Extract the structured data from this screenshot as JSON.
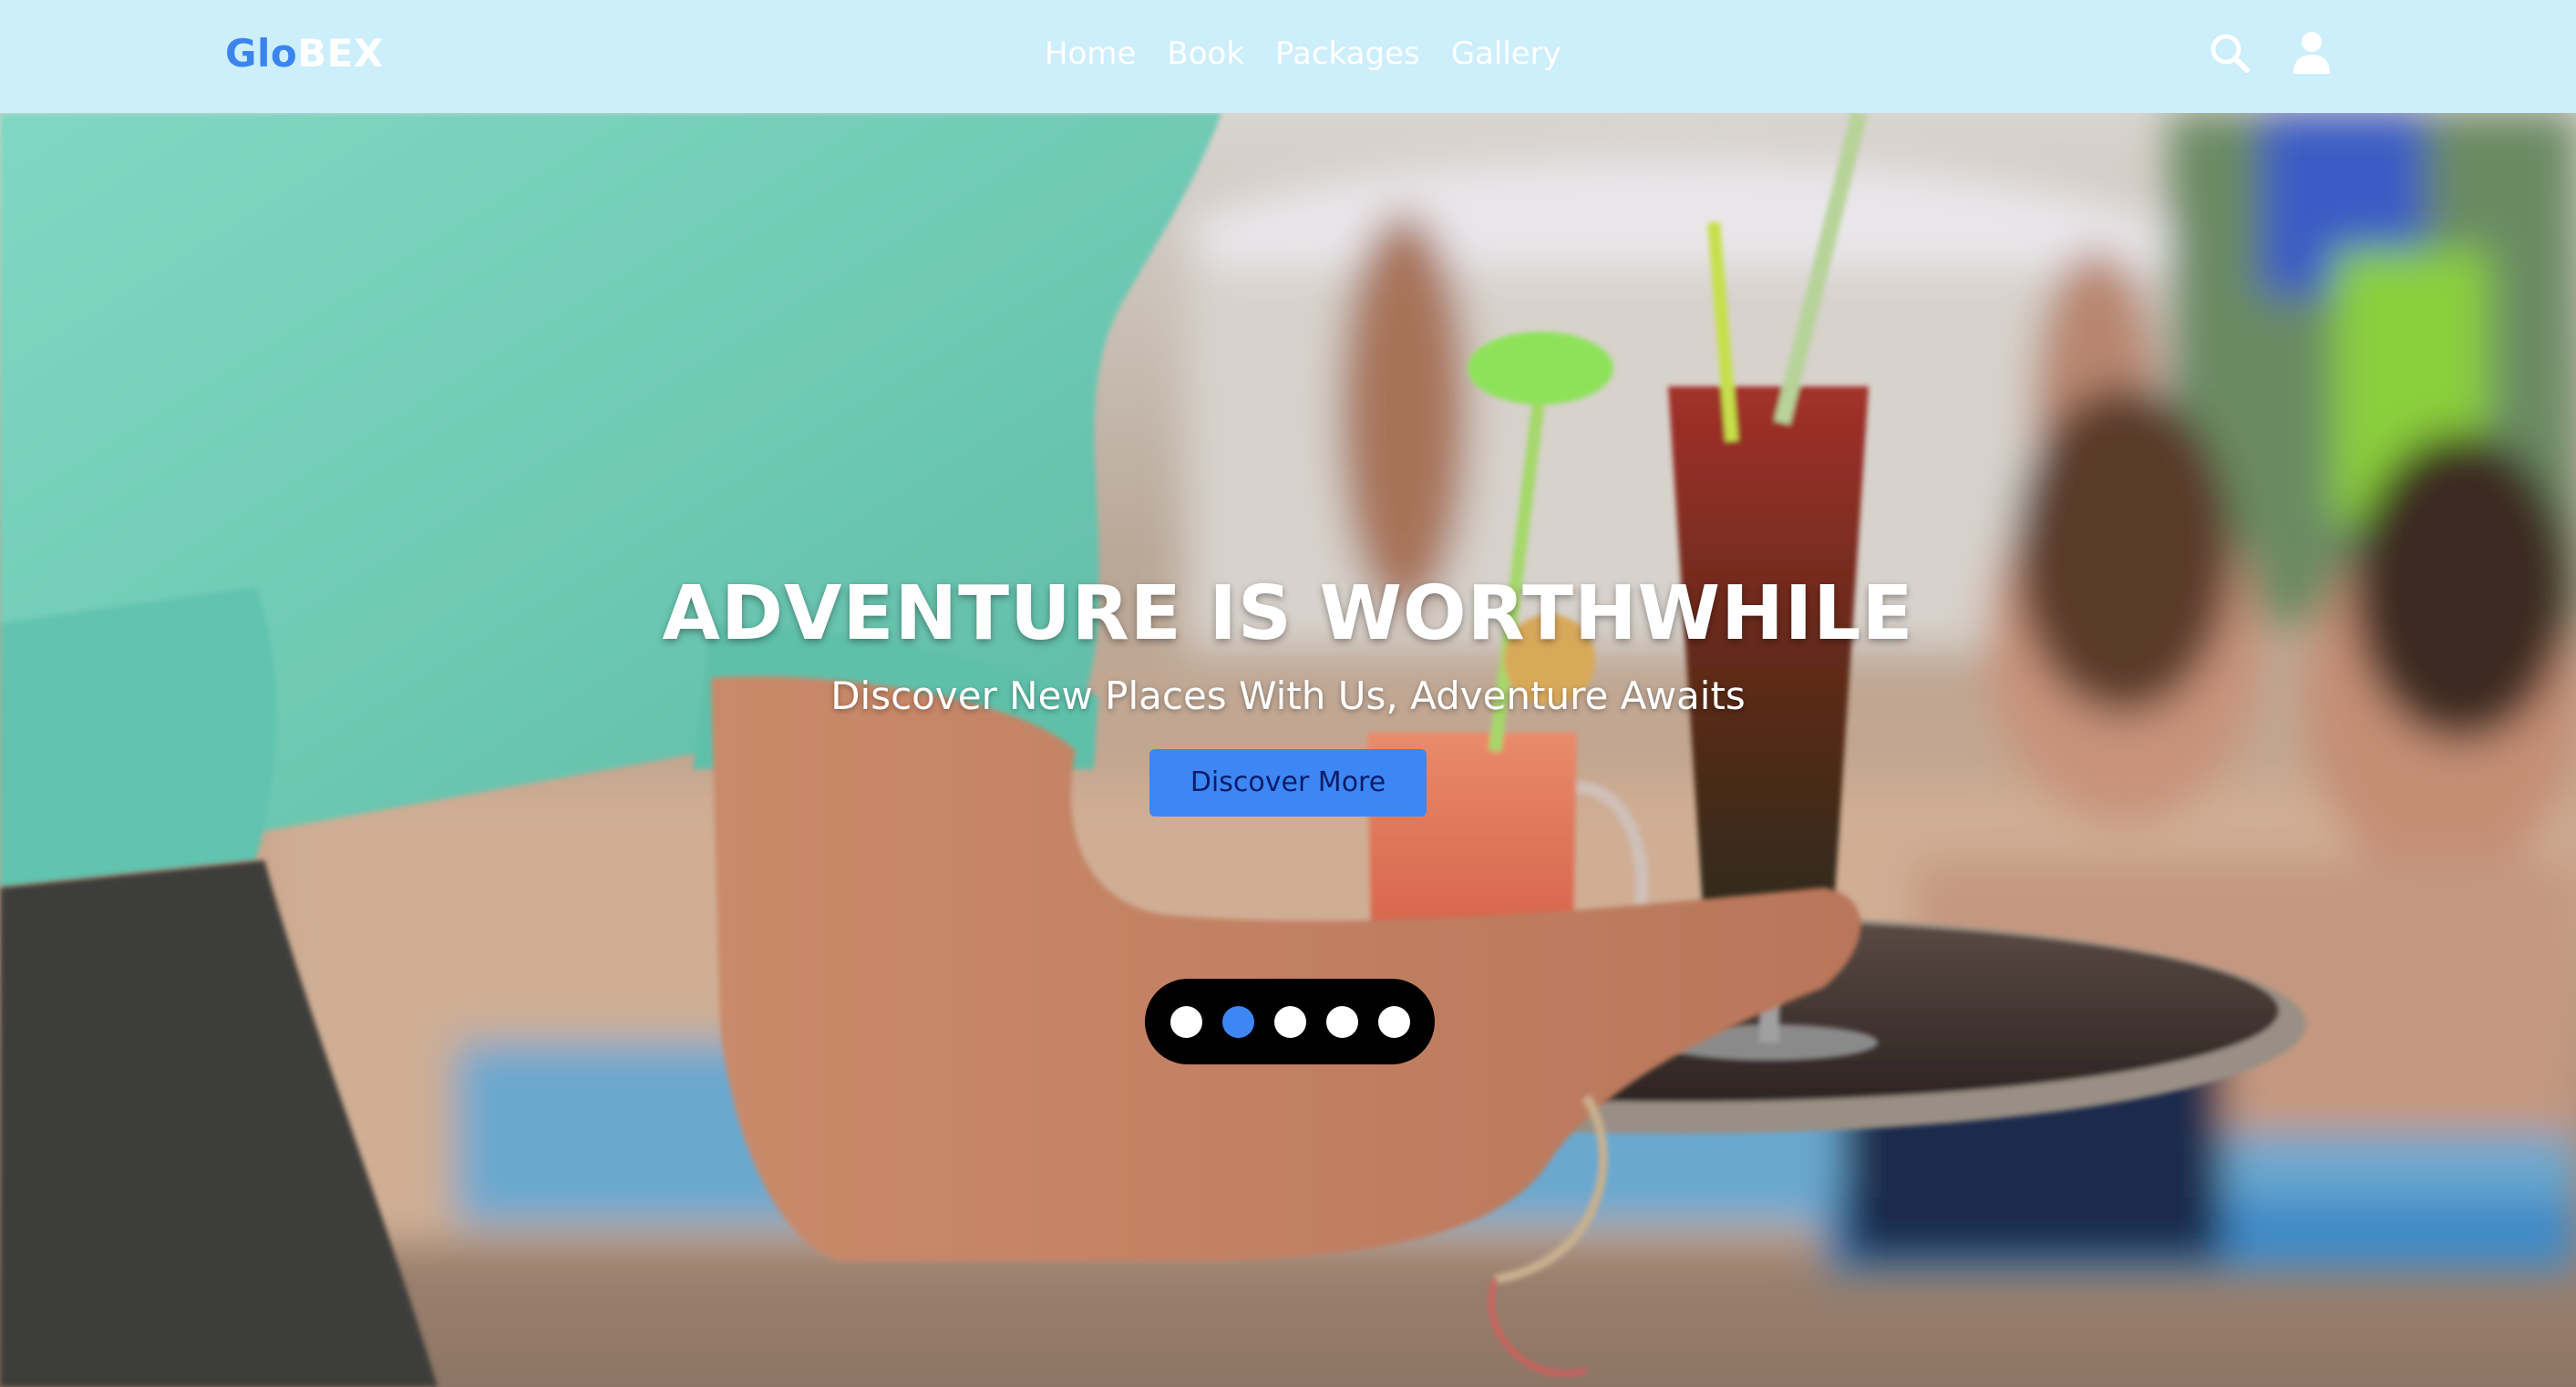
{
  "brand": {
    "logo_part1": "Glo",
    "logo_part2": "BEX",
    "accent_color": "#3b84f0",
    "header_bg": "#cdeefb"
  },
  "nav": {
    "items": [
      {
        "label": "Home"
      },
      {
        "label": "Book"
      },
      {
        "label": "Packages"
      },
      {
        "label": "Gallery"
      }
    ]
  },
  "header_icons": {
    "search": "search-icon",
    "account": "user-icon"
  },
  "hero": {
    "title": "ADVENTURE IS WORTHWHILE",
    "subtitle": "Discover New Places With Us, Adventure Awaits",
    "button_label": "Discover More",
    "button_color": "#3d87f5"
  },
  "carousel": {
    "slide_count": 5,
    "active_index": 1
  }
}
